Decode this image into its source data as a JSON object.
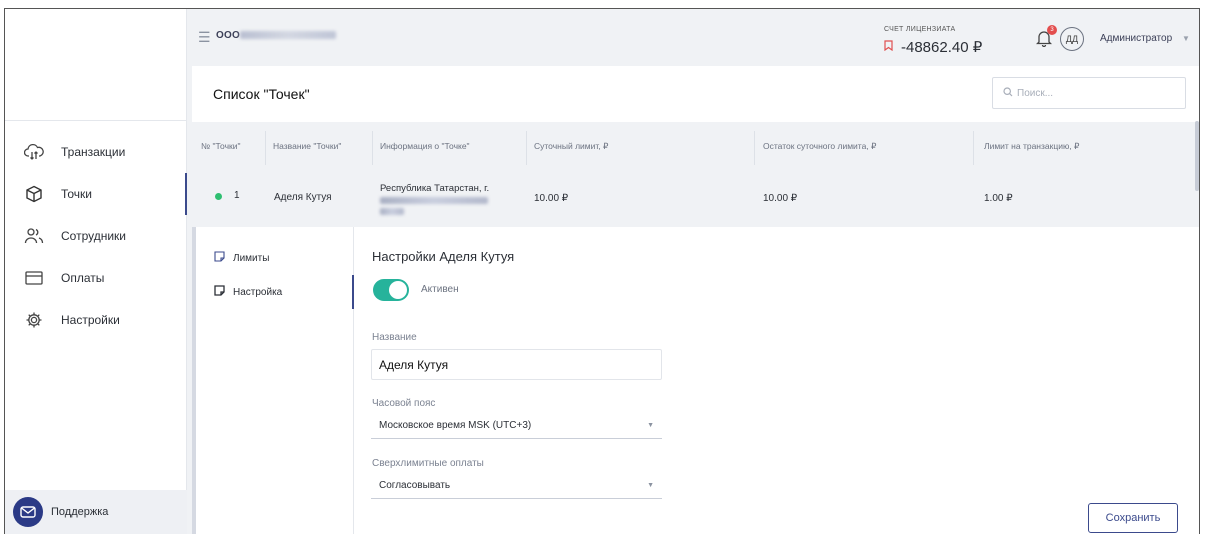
{
  "header": {
    "org_name": "ООО",
    "account_label": "СЧЕТ ЛИЦЕНЗИАТА",
    "account_value": "-48862.40 ₽",
    "avatar_initials": "ДД",
    "user_name": "Администратор",
    "notification_count": "3"
  },
  "sidebar": {
    "items": [
      {
        "label": "Транзакции",
        "icon": "cloud-transfer-icon"
      },
      {
        "label": "Точки",
        "icon": "cube-icon"
      },
      {
        "label": "Сотрудники",
        "icon": "users-icon"
      },
      {
        "label": "Оплаты",
        "icon": "credit-card-icon"
      },
      {
        "label": "Настройки",
        "icon": "gear-icon"
      }
    ],
    "support_label": "Поддержка"
  },
  "page": {
    "title": "Список \"Точек\"",
    "search_placeholder": "Поиск..."
  },
  "table": {
    "columns": [
      "№ \"Точки\"",
      "Название \"Точки\"",
      "Информация о \"Точке\"",
      "Суточный лимит, ₽",
      "Остаток суточного лимита, ₽",
      "Лимит на транзакцию, ₽"
    ],
    "row": {
      "number": "1",
      "name": "Аделя Кутуя",
      "info": "Республика Татарстан, г.",
      "daily_limit": "10.00 ₽",
      "daily_remaining": "10.00 ₽",
      "transaction_limit": "1.00 ₽"
    }
  },
  "detail": {
    "tabs": [
      "Лимиты",
      "Настройка"
    ],
    "title": "Настройки Аделя Кутуя",
    "toggle_label": "Активен",
    "name_label": "Название",
    "name_value": "Аделя Кутуя",
    "timezone_label": "Часовой пояс",
    "timezone_value": "Московское время MSK (UTC+3)",
    "overlimit_label": "Сверхлимитные оплаты",
    "overlimit_value": "Согласовывать",
    "save_label": "Сохранить"
  },
  "colors": {
    "accent": "#3b4a8c",
    "toggle_on": "#26b39b",
    "status_active": "#2fbf71",
    "notification_badge": "#e34e4e"
  }
}
